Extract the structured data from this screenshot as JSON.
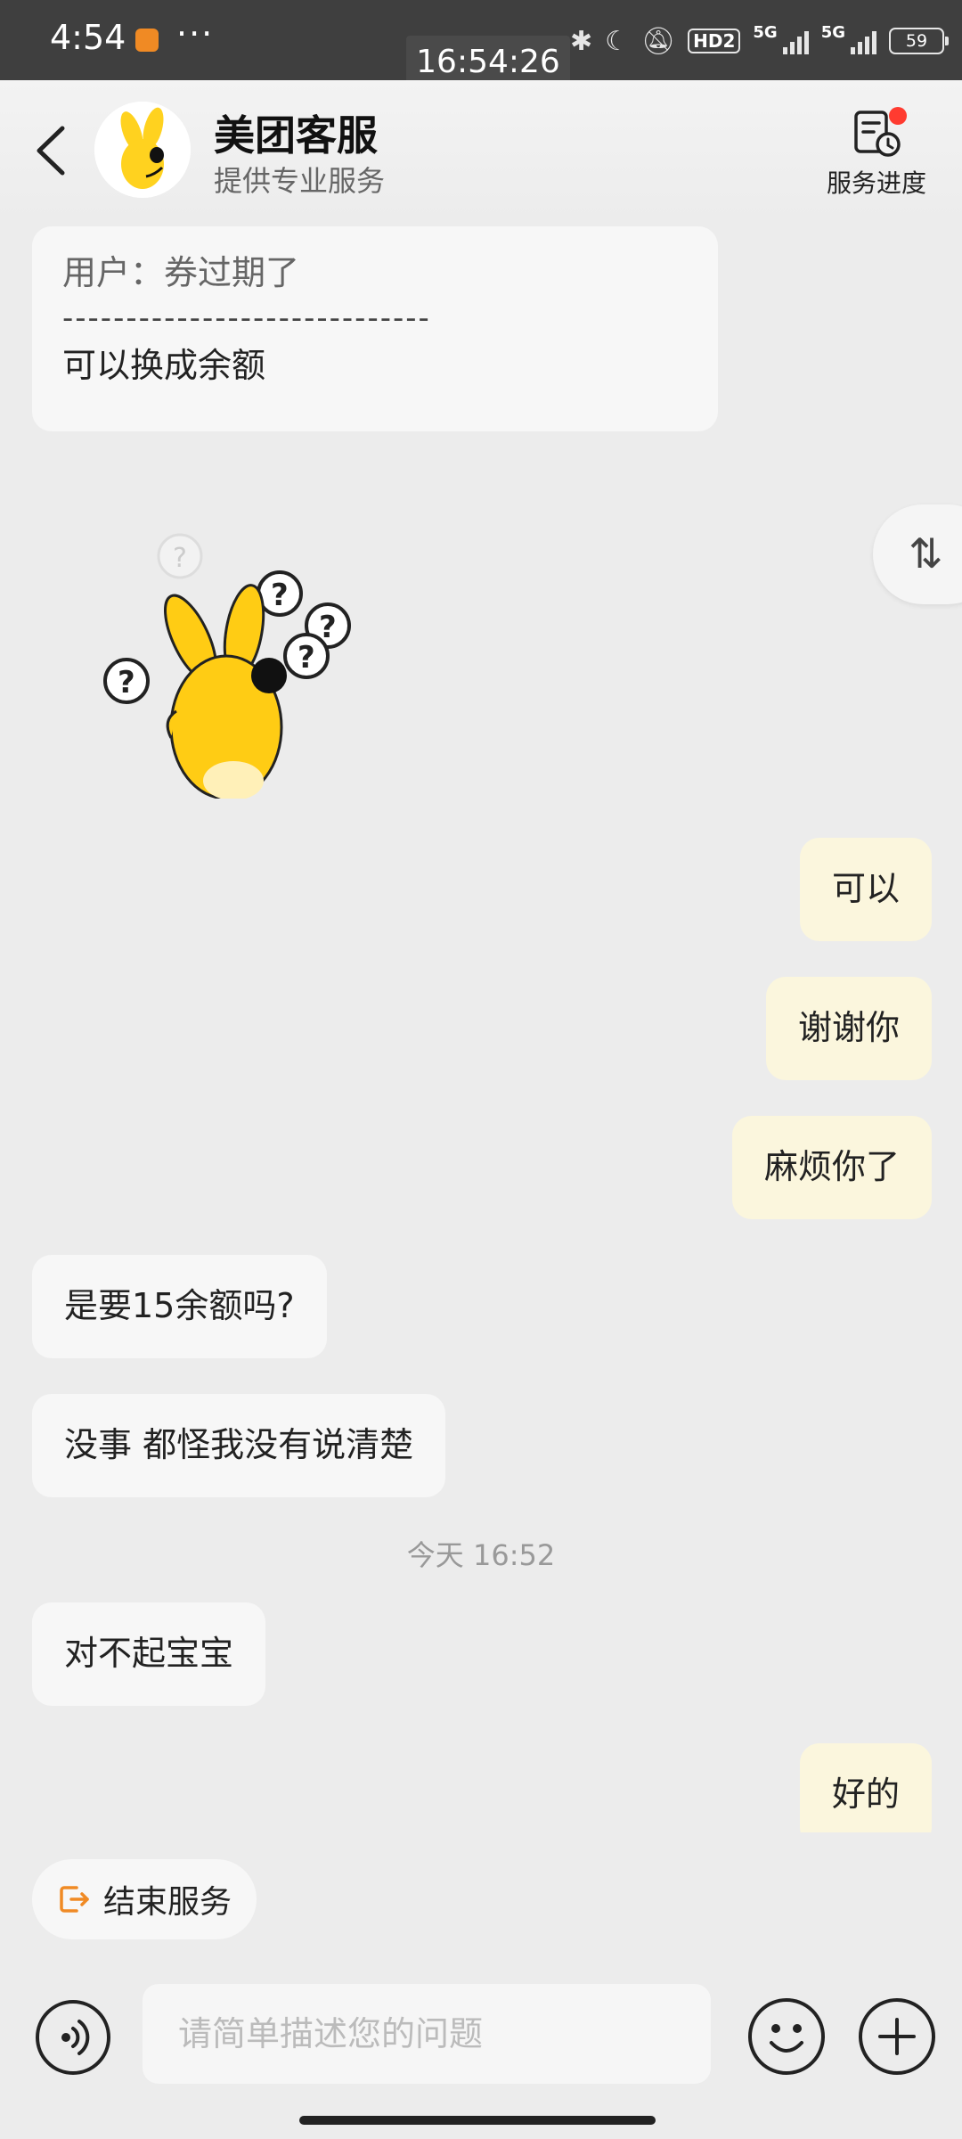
{
  "status_bar": {
    "time": "4:54",
    "dots": "···",
    "hd": "HD2",
    "net1": "5G",
    "net2": "5G",
    "battery": "59",
    "overlay_clock": "16:54:26"
  },
  "header": {
    "title": "美团客服",
    "subtitle": "提供专业服务",
    "progress_label": "服务进度"
  },
  "messages": [
    {
      "side": "left",
      "quote_user": "用户：券过期了",
      "divider": "-----------------------------",
      "text": "可以换成余额"
    },
    {
      "side": "left",
      "type": "sticker"
    },
    {
      "side": "right",
      "text": "可以"
    },
    {
      "side": "right",
      "text": "谢谢你"
    },
    {
      "side": "right",
      "text": "麻烦你了"
    },
    {
      "side": "left",
      "text": "是要15余额吗?"
    },
    {
      "side": "left",
      "text": "没事 都怪我没有说清楚"
    },
    {
      "type": "timestamp",
      "text": "今天 16:52"
    },
    {
      "side": "left",
      "text": "对不起宝宝"
    },
    {
      "side": "right",
      "text": "好的"
    }
  ],
  "scroll_fab": "⇅",
  "end_service": {
    "label": "结束服务"
  },
  "input": {
    "placeholder": "请简单描述您的问题"
  },
  "colors": {
    "accent": "#f08a24",
    "user_bubble": "#fbf6dd",
    "agent_bubble": "#f7f7f7",
    "badge": "#ff3b30"
  }
}
